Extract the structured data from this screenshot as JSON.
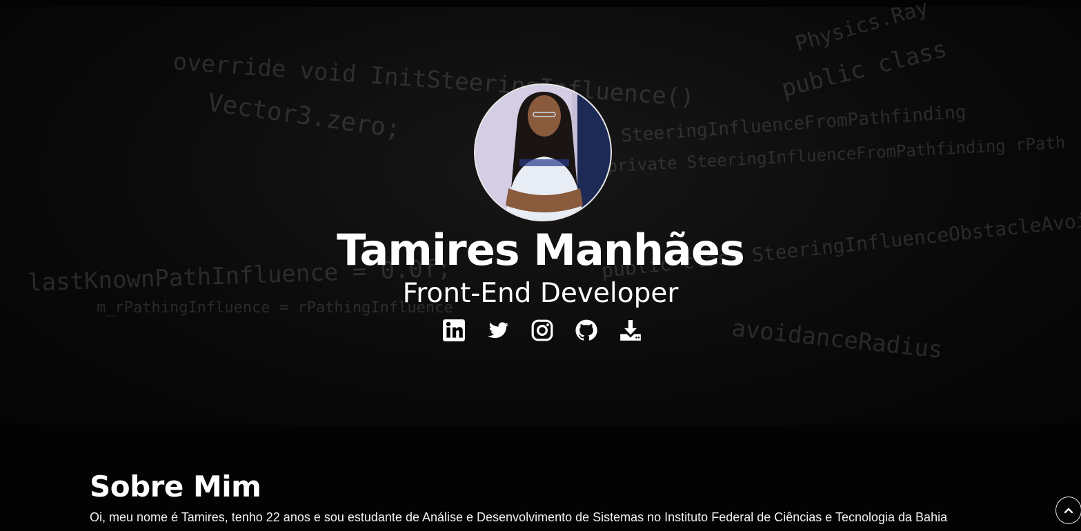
{
  "hero": {
    "name": "Tamires Manhães",
    "role": "Front-End Developer",
    "background_code_lines": [
      "m_rPathingInfluence = rPathingInfluence",
      "override void InitSteeringInfluence()",
      "private SteeringInfluenceFromPathfinding rPath",
      "public class SteeringInfluenceObstacleAvoidance",
      "lastKnownPathInfluence = 0.0f;",
      "avoidanceRadius",
      "Vector3.zero;",
      "public class",
      "Physics.Ray",
      "SteeringInfluenceFromPathfinding"
    ],
    "accent_color": "#ffffff",
    "background_color": "#050505"
  },
  "socials": [
    {
      "icon": "linkedin-icon"
    },
    {
      "icon": "twitter-icon"
    },
    {
      "icon": "instagram-icon"
    },
    {
      "icon": "github-icon"
    },
    {
      "icon": "download-icon"
    }
  ],
  "about": {
    "title": "Sobre Mim",
    "text": "Oi, meu nome é Tamires, tenho 22 anos e sou estudante de Análise e Desenvolvimento de Sistemas no Instituto Federal de Ciências e Tecnologia da Bahia"
  },
  "scroll_top": {
    "icon": "chevron-up-icon"
  }
}
